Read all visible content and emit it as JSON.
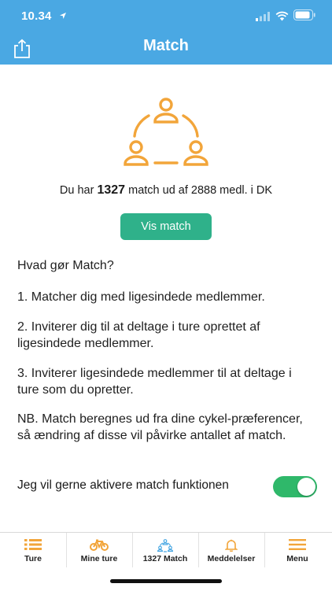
{
  "status_bar": {
    "time": "10.34"
  },
  "header": {
    "title": "Match"
  },
  "summary": {
    "prefix": "Du har",
    "count": "1327",
    "suffix": "match ud af 2888 medl. i DK"
  },
  "vis_match_button": "Vis match",
  "info": {
    "question": "Hvad gør Match?",
    "point1": "1. Matcher dig med ligesindede medlemmer.",
    "point2": "2. Inviterer dig til at deltage i ture oprettet af ligesindede medlemmer.",
    "point3": "3. Inviterer ligesindede medlemmer til at deltage i ture som du opretter.",
    "note": "NB. Match beregnes ud fra dine cykel-præferencer, så ændring af disse vil påvirke antallet af match."
  },
  "toggle": {
    "label": "Jeg vil gerne aktivere match funktionen",
    "enabled": true
  },
  "tabs": [
    {
      "label": "Ture",
      "icon": "list-icon"
    },
    {
      "label": "Mine ture",
      "icon": "bicycle-icon"
    },
    {
      "label": "1327 Match",
      "icon": "match-icon"
    },
    {
      "label": "Meddelelser",
      "icon": "bell-icon"
    },
    {
      "label": "Menu",
      "icon": "menu-icon"
    }
  ],
  "colors": {
    "header": "#4aa8e3",
    "accent": "#f2a53a",
    "button": "#2fb18a",
    "toggle_on": "#2fb86a"
  }
}
